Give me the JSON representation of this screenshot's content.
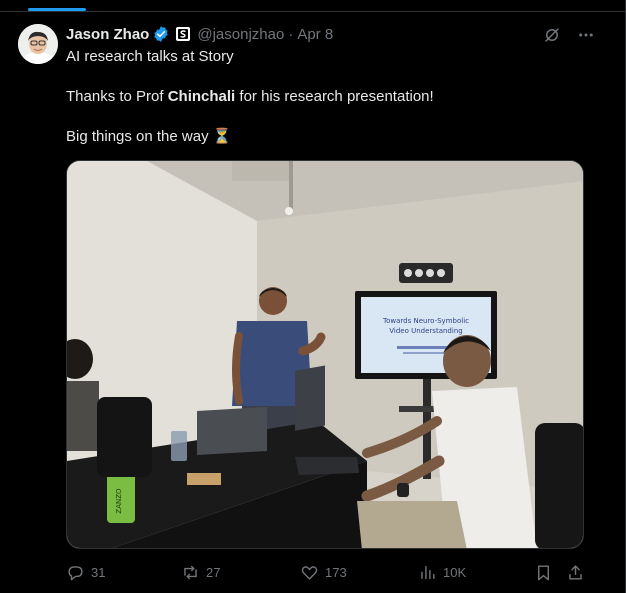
{
  "post": {
    "author": {
      "display_name": "Jason Zhao",
      "handle": "@jasonjzhao",
      "separator": "·",
      "date": "Apr 8"
    },
    "text": {
      "line1": "AI research talks at Story",
      "line2_prefix": "Thanks to Prof ",
      "line2_bold": "Chinchali",
      "line2_suffix": " for his research presentation!",
      "line3": "Big things on the way",
      "line3_emoji": "⏳"
    },
    "media": {
      "slide_title_line1": "Towards Neuro-Symbolic",
      "slide_title_line2": "Video Understanding",
      "can_label": "ZANZO"
    },
    "actions": {
      "replies": "31",
      "reposts": "27",
      "likes": "173",
      "views": "10K"
    }
  },
  "colors": {
    "background": "#000000",
    "text_primary": "#e7e9ea",
    "text_secondary": "#71767b",
    "accent": "#1d9bf0",
    "border": "#2f3336"
  }
}
